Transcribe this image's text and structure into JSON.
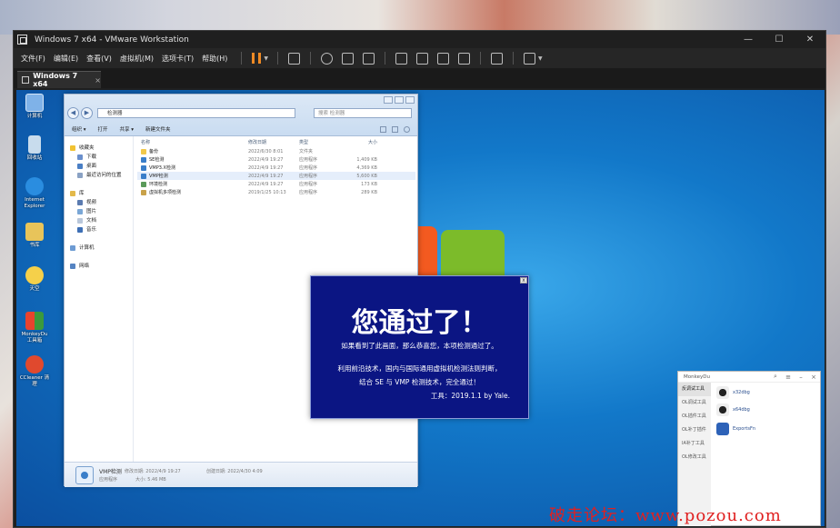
{
  "vmware": {
    "title": "Windows 7 x64 - VMware Workstation",
    "menus": [
      "文件(F)",
      "编辑(E)",
      "查看(V)",
      "虚拟机(M)",
      "选项卡(T)",
      "帮助(H)"
    ],
    "tab_label": "Windows 7 x64",
    "tab_close": "×"
  },
  "desktop": {
    "icons": [
      {
        "label": "计算机"
      },
      {
        "label": "回收站"
      },
      {
        "label": "Internet Explorer"
      },
      {
        "label": "书库"
      },
      {
        "label": "天空"
      },
      {
        "label": "MonkeyDu 工具箱"
      },
      {
        "label": "CCleaner 清理"
      }
    ]
  },
  "explorer": {
    "address": "检测器",
    "search_placeholder": "搜索 检测器",
    "commands": [
      "组织 ▾",
      "打开",
      "共享 ▾",
      "新建文件夹"
    ],
    "nav": {
      "favorites_header": "收藏夹",
      "favorites": [
        "下载",
        "桌面",
        "最近访问的位置"
      ],
      "libraries_header": "库",
      "libraries": [
        "视频",
        "图片",
        "文档",
        "音乐"
      ],
      "computer": "计算机",
      "network": "网络"
    },
    "columns": {
      "name": "名称",
      "date": "修改日期",
      "type": "类型",
      "size": "大小"
    },
    "files": [
      {
        "name": "备份",
        "date": "2022/6/30 8:01",
        "type": "文件夹",
        "size": ""
      },
      {
        "name": "SE检测",
        "date": "2022/4/9 19:27",
        "type": "应用程序",
        "size": "1,409 KB"
      },
      {
        "name": "VMP3.X检测",
        "date": "2022/4/9 19:27",
        "type": "应用程序",
        "size": "4,369 KB"
      },
      {
        "name": "VMP检测",
        "date": "2022/4/9 19:27",
        "type": "应用程序",
        "size": "5,600 KB"
      },
      {
        "name": "环境检测",
        "date": "2022/4/9 19:27",
        "type": "应用程序",
        "size": "173 KB"
      },
      {
        "name": "虚拟机多项检测",
        "date": "2019/1/25 10:13",
        "type": "应用程序",
        "size": "289 KB"
      }
    ],
    "details": {
      "name": "VMP检测",
      "type": "应用程序",
      "modified": "修改日期: 2022/4/9 19:27",
      "created": "创建日期: 2022/4/30 4:09",
      "size": "大小: 5.46 MB"
    }
  },
  "dialog": {
    "close": "x",
    "headline": "您通过了！",
    "line1": "如果看到了此画面，那么恭喜您，本项检测通过了。",
    "line2": "利用前沿技术，国内与国际通用虚拟机检测法则判断，",
    "line3": "结合 SE 与 VMP 检测技术，完全通过！",
    "signature": "工具：2019.1.1  by Yale."
  },
  "monkey": {
    "title": "MonkeyDu",
    "categories": [
      "反调试工具",
      "OL调试工具",
      "OL插件工具",
      "OL补丁插件",
      "IA补丁工具",
      "OL修改工具"
    ],
    "tools": [
      "x32dbg",
      "x64dbg",
      "ExportsFn"
    ]
  },
  "watermark": "破走论坛：www.pozou.com",
  "colors": {
    "dialog_bg": "#0b1583",
    "vm_chrome": "#1f1f1f",
    "accent_pause": "#f08a24"
  }
}
